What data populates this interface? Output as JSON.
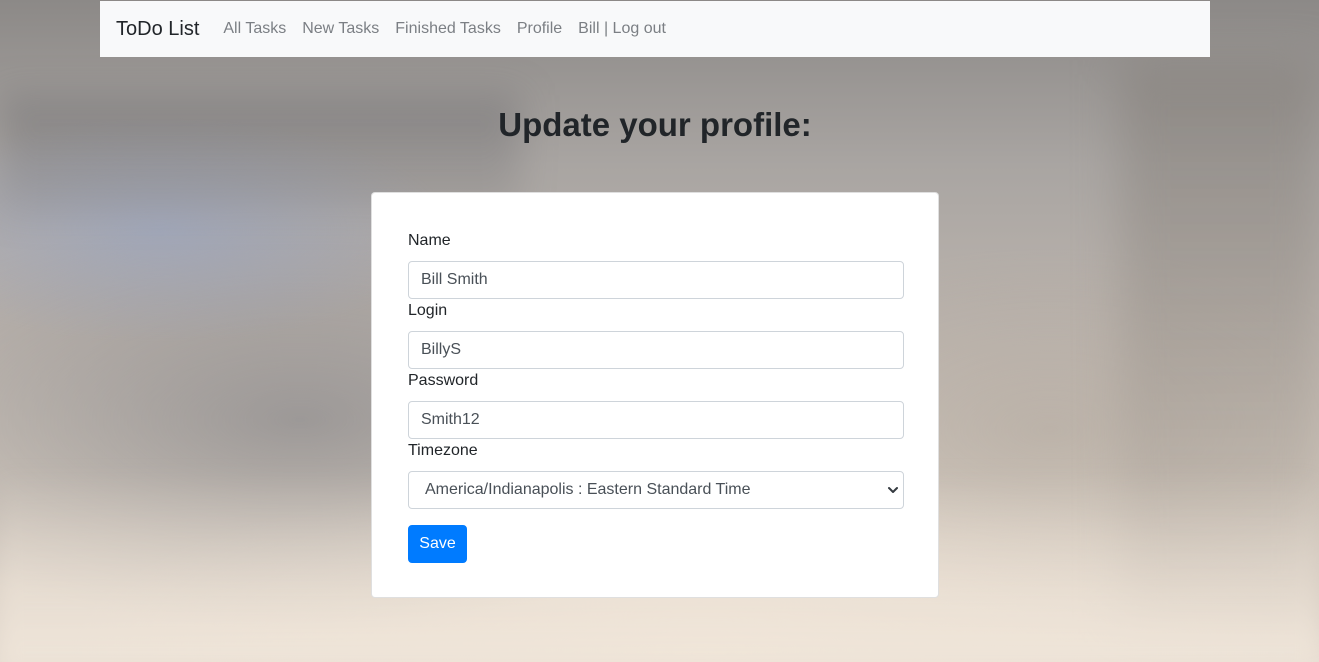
{
  "navbar": {
    "brand": "ToDo List",
    "links": [
      "All Tasks",
      "New Tasks",
      "Finished Tasks",
      "Profile",
      "Bill | Log out"
    ]
  },
  "page": {
    "title": "Update your profile:"
  },
  "form": {
    "name_label": "Name",
    "name_value": "Bill Smith",
    "login_label": "Login",
    "login_value": "BillyS",
    "password_label": "Password",
    "password_value": "Smith12",
    "timezone_label": "Timezone",
    "timezone_value": "America/Indianapolis : Eastern Standard Time",
    "save_label": "Save"
  },
  "colors": {
    "primary": "#007bff",
    "navbar_bg": "#f8f9fa"
  },
  "icons": {
    "select_arrow": "chevron-down-icon"
  }
}
